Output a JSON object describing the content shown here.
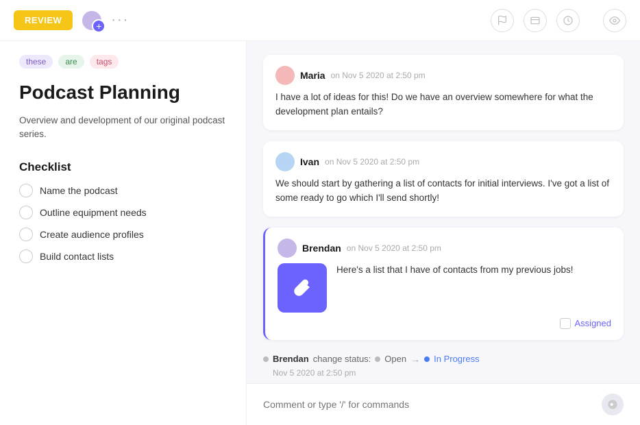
{
  "topbar": {
    "review_label": "REVIEW",
    "more_label": "···"
  },
  "tags": [
    {
      "id": "tag-these",
      "label": "these",
      "style": "tag-purple"
    },
    {
      "id": "tag-are",
      "label": "are",
      "style": "tag-green"
    },
    {
      "id": "tag-tags",
      "label": "tags",
      "style": "tag-pink"
    }
  ],
  "page": {
    "title": "Podcast Planning",
    "description": "Overview and development of our original podcast series."
  },
  "checklist": {
    "title": "Checklist",
    "items": [
      {
        "id": "item-1",
        "label": "Name the podcast"
      },
      {
        "id": "item-2",
        "label": "Outline equipment needs"
      },
      {
        "id": "item-3",
        "label": "Create audience profiles"
      },
      {
        "id": "item-4",
        "label": "Build contact lists"
      }
    ]
  },
  "comments": [
    {
      "id": "comment-maria",
      "author": "Maria",
      "time": "on Nov 5 2020 at 2:50 pm",
      "text": "I have a lot of ideas for this! Do we have an overview somewhere for what the development plan entails?",
      "avatar_class": "avatar-maria",
      "highlighted": false
    },
    {
      "id": "comment-ivan",
      "author": "Ivan",
      "time": "on Nov 5 2020 at 2:50 pm",
      "text": "We should start by gathering a list of contacts for initial interviews. I've got a list of some ready to go which I'll send shortly!",
      "avatar_class": "avatar-ivan",
      "highlighted": false
    },
    {
      "id": "comment-brendan",
      "author": "Brendan",
      "time": "on Nov 5 2020 at 2:50 pm",
      "text": "Here's a list that I have of contacts from my previous jobs!",
      "avatar_class": "avatar-brendan",
      "highlighted": true,
      "has_attachment": true,
      "assigned_label": "Assigned"
    }
  ],
  "status_change": {
    "author": "Brendan",
    "action": "change status:",
    "from": "Open",
    "to": "In Progress",
    "time": "Nov 5 2020 at 2:50 pm"
  },
  "comment_input": {
    "placeholder": "Comment or type '/' for commands"
  }
}
